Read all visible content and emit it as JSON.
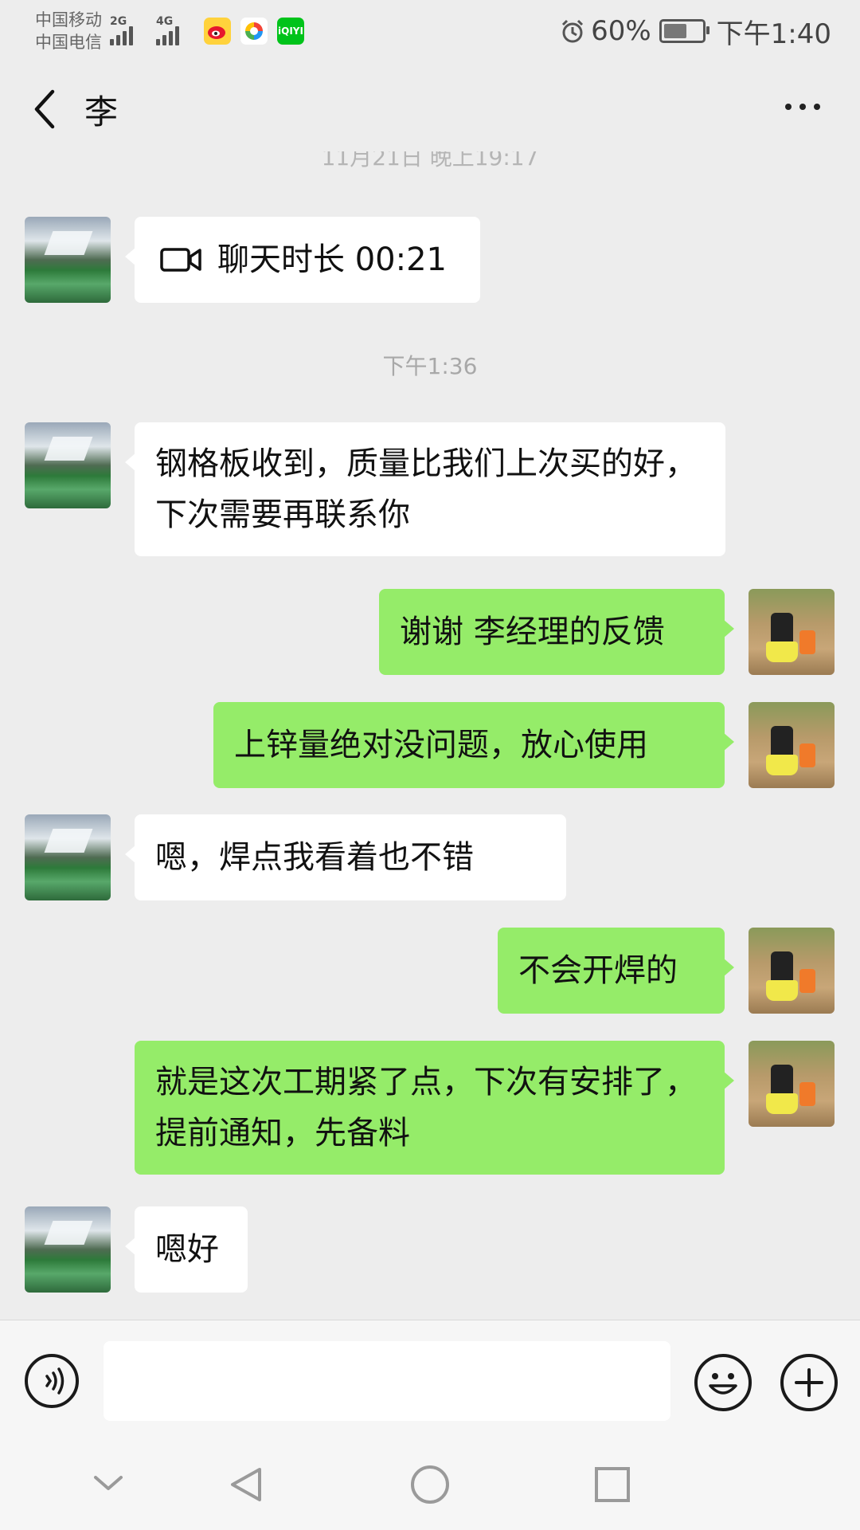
{
  "status_bar": {
    "carrier_1": "中国移动",
    "carrier_2": "中国电信",
    "signal_1_type": "2G",
    "signal_2_type": "4G",
    "app_icons": [
      "weibo-icon",
      "news-app-icon",
      "iqiyi-icon"
    ],
    "iqiyi_label": "iQIYI",
    "battery_percent": "60%",
    "battery_level": 0.6,
    "time": "下午1:40"
  },
  "header": {
    "title": "李"
  },
  "chat": {
    "cut_timestamp": "11月21日 晚上19:17",
    "call_record": {
      "label": "聊天时长 00:21"
    },
    "time_separator": "下午1:36",
    "messages": [
      {
        "side": "left",
        "text": "钢格板收到，质量比我们上次买的好，下次需要再联系你"
      },
      {
        "side": "right",
        "text": "谢谢 李经理的反馈"
      },
      {
        "side": "right",
        "text": "上锌量绝对没问题，放心使用"
      },
      {
        "side": "left",
        "text": "嗯，焊点我看着也不错"
      },
      {
        "side": "right",
        "text": "不会开焊的"
      },
      {
        "side": "right",
        "text": "就是这次工期紧了点，下次有安排了，提前通知，先备料"
      },
      {
        "side": "left",
        "text": "嗯好"
      }
    ]
  },
  "input_bar": {
    "text_value": "",
    "icons": [
      "voice-icon",
      "emoji-icon",
      "add-icon"
    ]
  },
  "navigation_bar": {
    "icons": [
      "hide-keyboard-icon",
      "back-triangle-icon",
      "home-circle-icon",
      "recents-square-icon"
    ]
  },
  "colors": {
    "background": "#ededed",
    "sent_bubble": "#95ec69",
    "received_bubble": "#ffffff"
  }
}
